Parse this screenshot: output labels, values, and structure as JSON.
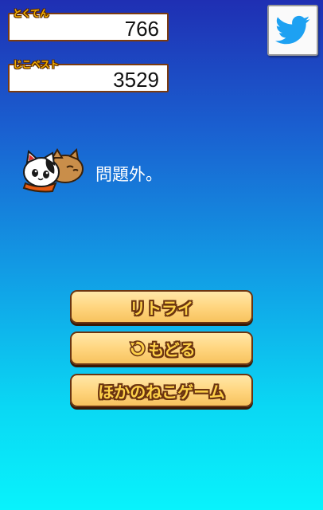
{
  "score": {
    "label": "とくてん",
    "value": "766"
  },
  "best": {
    "label": "じこベスト",
    "value": "3529"
  },
  "twitter": {
    "icon": "twitter-bird-icon"
  },
  "message": "問題外。",
  "buttons": {
    "retry": "リトライ",
    "back": "もどる",
    "other_games": "ほかのねこゲーム"
  },
  "colors": {
    "background_top": "#1f2fb3",
    "background_bottom": "#08f3fc",
    "button_fill": "#ffd680",
    "button_border": "#6b3410",
    "label_yellow": "#f5b000",
    "twitter_blue": "#1da1f2"
  }
}
